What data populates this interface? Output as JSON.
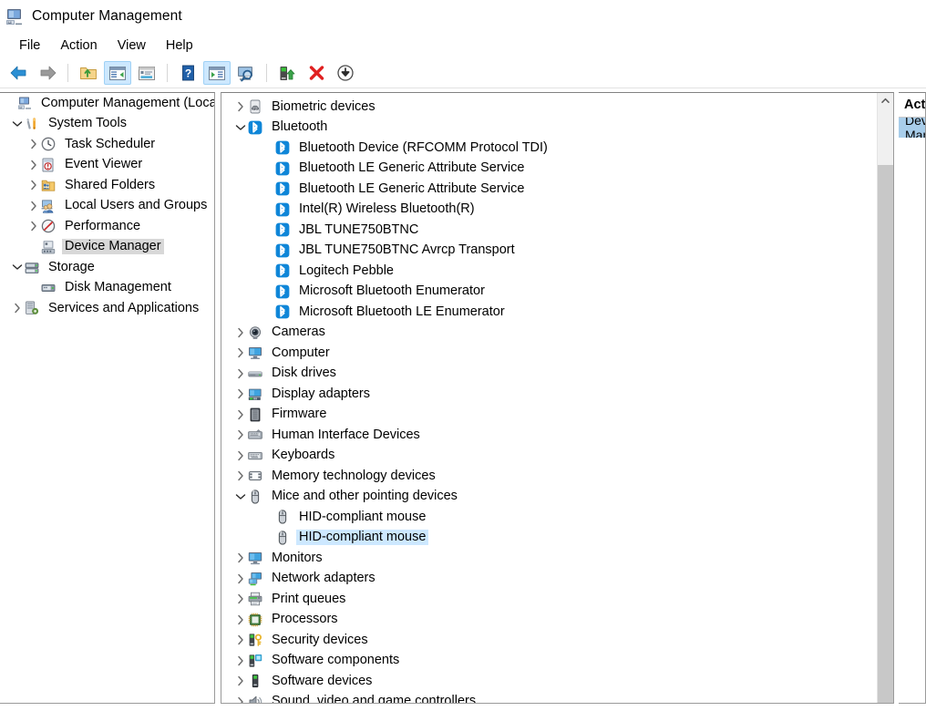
{
  "window": {
    "title": "Computer Management",
    "icon": "computer-management-icon"
  },
  "menubar": {
    "items": [
      {
        "label": "File"
      },
      {
        "label": "Action"
      },
      {
        "label": "View"
      },
      {
        "label": "Help"
      }
    ]
  },
  "toolbar": {
    "buttons": [
      {
        "name": "back-button",
        "icon": "back-arrow-icon",
        "toggled": false
      },
      {
        "name": "forward-button",
        "icon": "forward-arrow-icon",
        "toggled": false
      },
      {
        "name": "up-one-level-button",
        "icon": "folder-up-icon",
        "toggled": false
      },
      {
        "name": "show-hide-console-tree-button",
        "icon": "console-tree-icon",
        "toggled": true
      },
      {
        "name": "properties-button",
        "icon": "properties-window-icon",
        "toggled": false
      },
      {
        "name": "help-button",
        "icon": "question-mark-icon",
        "toggled": false
      },
      {
        "name": "show-hide-action-pane-button",
        "icon": "action-pane-icon",
        "toggled": true
      },
      {
        "name": "scan-for-hardware-changes-button",
        "icon": "monitor-search-icon",
        "toggled": false
      },
      {
        "name": "update-driver-button",
        "icon": "update-driver-icon",
        "toggled": false
      },
      {
        "name": "uninstall-device-button",
        "icon": "red-x-icon",
        "toggled": false
      },
      {
        "name": "disable-device-button",
        "icon": "down-arrow-circle-icon",
        "toggled": false
      }
    ]
  },
  "console_tree": {
    "items": [
      {
        "label": "Computer Management (Local)",
        "indent": 0,
        "icon": "computer-management-icon",
        "expander": "none",
        "selected": false
      },
      {
        "label": "System Tools",
        "indent": 1,
        "icon": "system-tools-icon",
        "expander": "expanded",
        "selected": false
      },
      {
        "label": "Task Scheduler",
        "indent": 2,
        "icon": "clock-icon",
        "expander": "collapsed",
        "selected": false
      },
      {
        "label": "Event Viewer",
        "indent": 2,
        "icon": "event-viewer-icon",
        "expander": "collapsed",
        "selected": false
      },
      {
        "label": "Shared Folders",
        "indent": 2,
        "icon": "shared-folders-icon",
        "expander": "collapsed",
        "selected": false
      },
      {
        "label": "Local Users and Groups",
        "indent": 2,
        "icon": "users-group-icon",
        "expander": "collapsed",
        "selected": false
      },
      {
        "label": "Performance",
        "indent": 2,
        "icon": "performance-gauge-icon",
        "expander": "collapsed",
        "selected": false
      },
      {
        "label": "Device Manager",
        "indent": 2,
        "icon": "device-manager-icon",
        "expander": "none",
        "selected": true
      },
      {
        "label": "Storage",
        "indent": 1,
        "icon": "storage-icon",
        "expander": "expanded",
        "selected": false
      },
      {
        "label": "Disk Management",
        "indent": 2,
        "icon": "disk-management-icon",
        "expander": "none",
        "selected": false
      },
      {
        "label": "Services and Applications",
        "indent": 1,
        "icon": "services-applications-icon",
        "expander": "collapsed",
        "selected": false
      }
    ]
  },
  "device_tree": {
    "items": [
      {
        "label": "Biometric devices",
        "indent": 0,
        "icon": "fingerprint-icon",
        "expander": "collapsed",
        "selected": false
      },
      {
        "label": "Bluetooth",
        "indent": 0,
        "icon": "bluetooth-icon",
        "expander": "expanded",
        "selected": false
      },
      {
        "label": "Bluetooth Device (RFCOMM Protocol TDI)",
        "indent": 1,
        "icon": "bluetooth-icon",
        "expander": "none",
        "selected": false
      },
      {
        "label": "Bluetooth LE Generic Attribute Service",
        "indent": 1,
        "icon": "bluetooth-icon",
        "expander": "none",
        "selected": false
      },
      {
        "label": "Bluetooth LE Generic Attribute Service",
        "indent": 1,
        "icon": "bluetooth-icon",
        "expander": "none",
        "selected": false
      },
      {
        "label": "Intel(R) Wireless Bluetooth(R)",
        "indent": 1,
        "icon": "bluetooth-icon",
        "expander": "none",
        "selected": false
      },
      {
        "label": "JBL TUNE750BTNC",
        "indent": 1,
        "icon": "bluetooth-icon",
        "expander": "none",
        "selected": false
      },
      {
        "label": "JBL TUNE750BTNC Avrcp Transport",
        "indent": 1,
        "icon": "bluetooth-icon",
        "expander": "none",
        "selected": false
      },
      {
        "label": "Logitech Pebble",
        "indent": 1,
        "icon": "bluetooth-icon",
        "expander": "none",
        "selected": false
      },
      {
        "label": "Microsoft Bluetooth Enumerator",
        "indent": 1,
        "icon": "bluetooth-icon",
        "expander": "none",
        "selected": false
      },
      {
        "label": "Microsoft Bluetooth LE Enumerator",
        "indent": 1,
        "icon": "bluetooth-icon",
        "expander": "none",
        "selected": false
      },
      {
        "label": "Cameras",
        "indent": 0,
        "icon": "camera-icon",
        "expander": "collapsed",
        "selected": false
      },
      {
        "label": "Computer",
        "indent": 0,
        "icon": "computer-icon",
        "expander": "collapsed",
        "selected": false
      },
      {
        "label": "Disk drives",
        "indent": 0,
        "icon": "disk-drive-icon",
        "expander": "collapsed",
        "selected": false
      },
      {
        "label": "Display adapters",
        "indent": 0,
        "icon": "display-adapter-icon",
        "expander": "collapsed",
        "selected": false
      },
      {
        "label": "Firmware",
        "indent": 0,
        "icon": "firmware-chip-icon",
        "expander": "collapsed",
        "selected": false
      },
      {
        "label": "Human Interface Devices",
        "indent": 0,
        "icon": "hid-icon",
        "expander": "collapsed",
        "selected": false
      },
      {
        "label": "Keyboards",
        "indent": 0,
        "icon": "keyboard-icon",
        "expander": "collapsed",
        "selected": false
      },
      {
        "label": "Memory technology devices",
        "indent": 0,
        "icon": "memory-card-icon",
        "expander": "collapsed",
        "selected": false
      },
      {
        "label": "Mice and other pointing devices",
        "indent": 0,
        "icon": "mouse-icon",
        "expander": "expanded",
        "selected": false
      },
      {
        "label": "HID-compliant mouse",
        "indent": 1,
        "icon": "mouse-icon",
        "expander": "none",
        "selected": false
      },
      {
        "label": "HID-compliant mouse",
        "indent": 1,
        "icon": "mouse-icon",
        "expander": "none",
        "selected": true
      },
      {
        "label": "Monitors",
        "indent": 0,
        "icon": "monitor-icon",
        "expander": "collapsed",
        "selected": false
      },
      {
        "label": "Network adapters",
        "indent": 0,
        "icon": "network-adapter-icon",
        "expander": "collapsed",
        "selected": false
      },
      {
        "label": "Print queues",
        "indent": 0,
        "icon": "printer-icon",
        "expander": "collapsed",
        "selected": false
      },
      {
        "label": "Processors",
        "indent": 0,
        "icon": "processor-icon",
        "expander": "collapsed",
        "selected": false
      },
      {
        "label": "Security devices",
        "indent": 0,
        "icon": "security-key-icon",
        "expander": "collapsed",
        "selected": false
      },
      {
        "label": "Software components",
        "indent": 0,
        "icon": "software-component-icon",
        "expander": "collapsed",
        "selected": false
      },
      {
        "label": "Software devices",
        "indent": 0,
        "icon": "software-device-icon",
        "expander": "collapsed",
        "selected": false
      },
      {
        "label": "Sound, video and game controllers",
        "indent": 0,
        "icon": "speaker-icon",
        "expander": "collapsed",
        "selected": false
      }
    ]
  },
  "actions_pane": {
    "title": "Actions",
    "items": [
      {
        "label": "Device Manager",
        "selected": true
      }
    ]
  },
  "scrollbar": {
    "up_arrow": "chevron-up-icon"
  },
  "colors": {
    "selection_active": "#cde8ff",
    "selection_inactive": "#d8d8d8",
    "actions_selected": "#a8cdea",
    "toolbar_toggled": "#cde8ff",
    "bluetooth_blue": "#0f86d8"
  }
}
